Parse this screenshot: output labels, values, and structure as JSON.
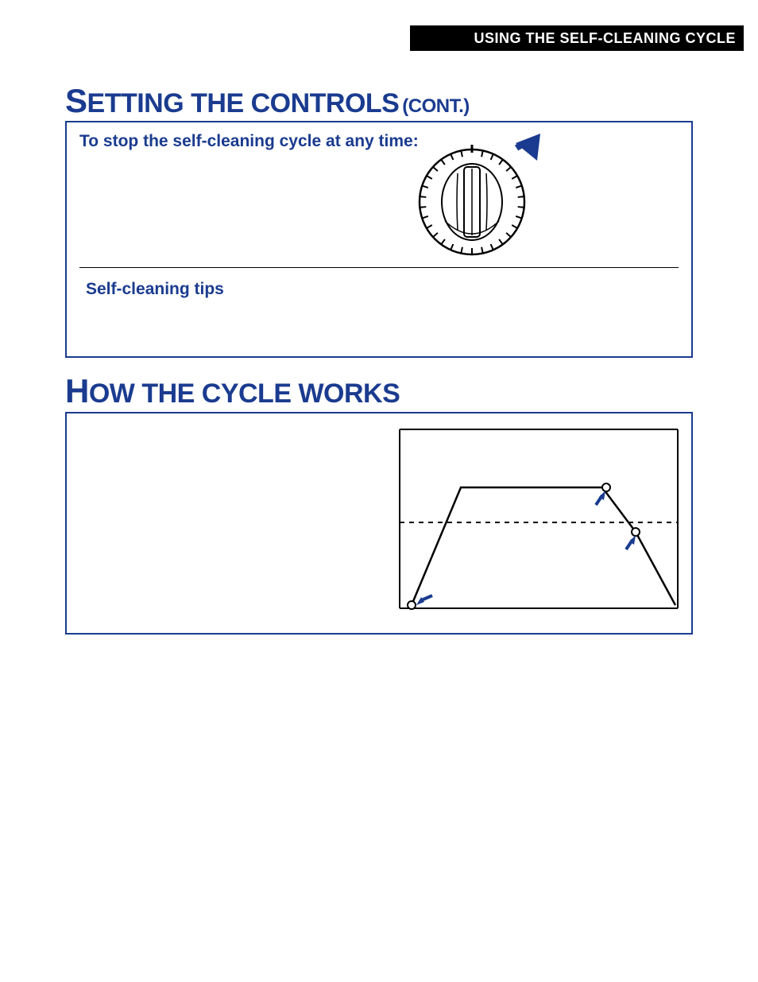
{
  "header": {
    "title": "USING THE SELF-CLEANING CYCLE"
  },
  "section1": {
    "title_big_initial": "S",
    "title_rest": "ETTING THE CONTROLS",
    "title_cont": "(CONT.)",
    "stop_heading": "To stop the self-cleaning cycle at any time:",
    "tips_heading": "Self-cleaning tips"
  },
  "section2": {
    "title_big_initial": "H",
    "title_rest": "OW THE CYCLE WORKS"
  },
  "icons": {
    "knob": "oven-dial-knob",
    "arrow": "direction-arrow",
    "chart": "cycle-temperature-chart"
  }
}
